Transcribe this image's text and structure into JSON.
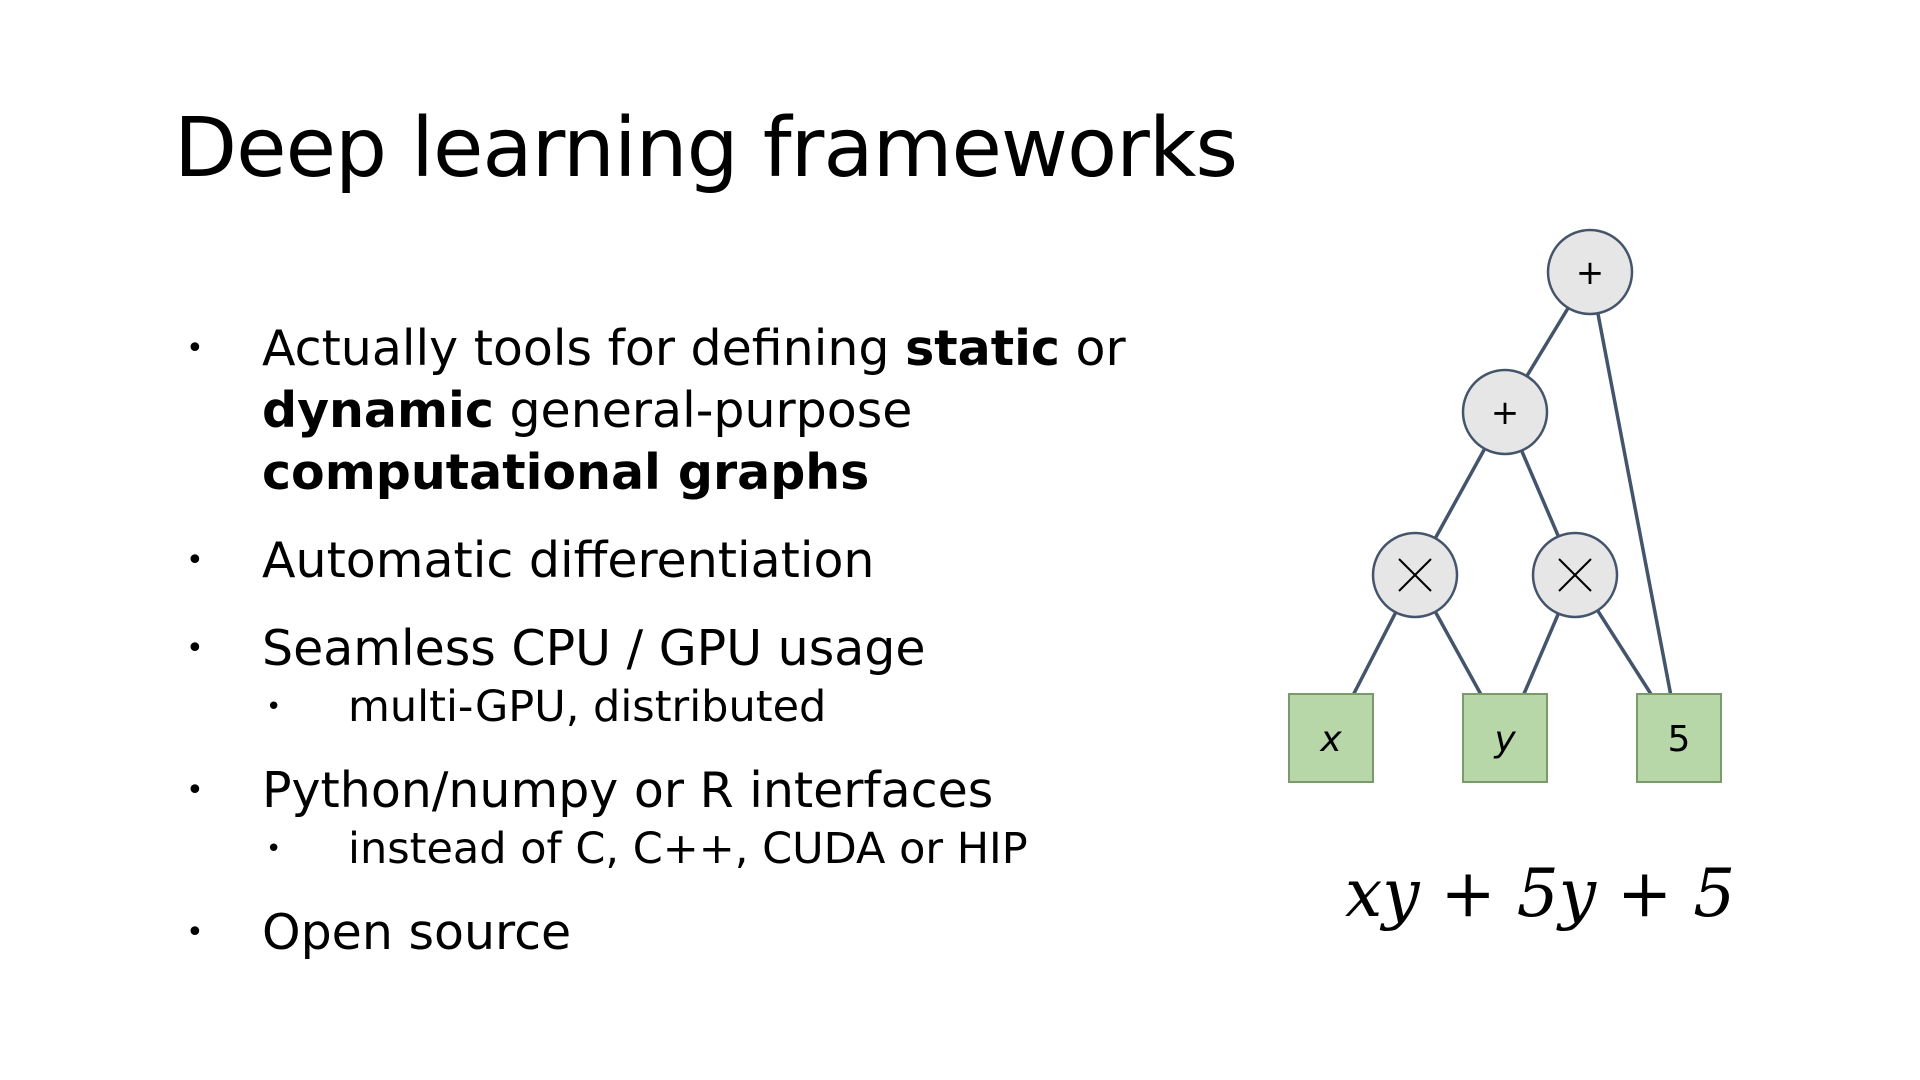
{
  "slide": {
    "title": "Deep learning frameworks"
  },
  "bullets": [
    {
      "parts": [
        {
          "text": "Actually tools for defining ",
          "bold": false
        },
        {
          "text": "static",
          "bold": true
        },
        {
          "text": " or ",
          "bold": false
        },
        {
          "text": "dynamic",
          "bold": true
        },
        {
          "text": " general-purpose ",
          "bold": false
        },
        {
          "text": "computational graphs",
          "bold": true
        }
      ],
      "sub": []
    },
    {
      "parts": [
        {
          "text": "Automatic differentiation",
          "bold": false
        }
      ],
      "sub": []
    },
    {
      "parts": [
        {
          "text": "Seamless CPU / GPU usage",
          "bold": false
        }
      ],
      "sub": [
        "multi-GPU, distributed"
      ]
    },
    {
      "parts": [
        {
          "text": "Python/numpy or R interfaces",
          "bold": false
        }
      ],
      "sub": [
        "instead of C, C++, CUDA or HIP"
      ]
    },
    {
      "parts": [
        {
          "text": "Open source",
          "bold": false
        }
      ],
      "sub": []
    }
  ],
  "graph": {
    "colors": {
      "op_fill": "#e6e6e6",
      "leaf_fill": "#b7d7a8",
      "stroke": "#44546a",
      "leaf_stroke": "#7a9a6a"
    },
    "ops": [
      {
        "id": "plus_top",
        "label": "+"
      },
      {
        "id": "plus_mid",
        "label": "+"
      },
      {
        "id": "mul_left",
        "label": "×"
      },
      {
        "id": "mul_right",
        "label": "×"
      }
    ],
    "leaves": [
      {
        "id": "x",
        "label": "x",
        "italic": true
      },
      {
        "id": "y",
        "label": "y",
        "italic": true
      },
      {
        "id": "five",
        "label": "5",
        "italic": false
      }
    ],
    "edges": [
      [
        "plus_top",
        "plus_mid"
      ],
      [
        "plus_top",
        "five"
      ],
      [
        "plus_mid",
        "mul_left"
      ],
      [
        "plus_mid",
        "mul_right"
      ],
      [
        "mul_left",
        "x"
      ],
      [
        "mul_left",
        "y"
      ],
      [
        "mul_right",
        "y"
      ],
      [
        "mul_right",
        "five"
      ]
    ]
  },
  "formula": "xy + 5y + 5"
}
